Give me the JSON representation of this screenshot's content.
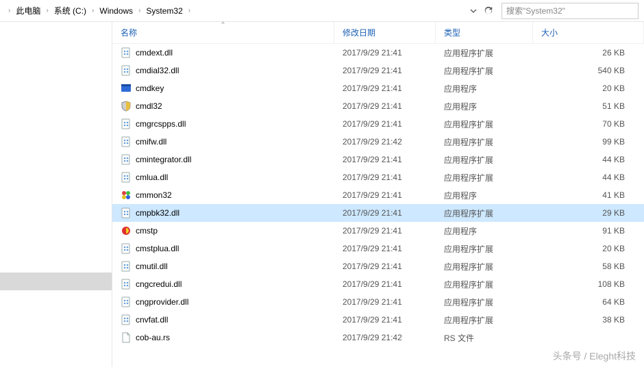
{
  "breadcrumb": {
    "items": [
      "此电脑",
      "系统 (C:)",
      "Windows",
      "System32"
    ]
  },
  "search": {
    "placeholder": "搜索\"System32\""
  },
  "columns": {
    "name": "名称",
    "date": "修改日期",
    "type": "类型",
    "size": "大小"
  },
  "types": {
    "dll": "应用程序扩展",
    "exe": "应用程序",
    "rs": "RS 文件"
  },
  "files": [
    {
      "icon": "dll",
      "name": "cmdext.dll",
      "date": "2017/9/29 21:41",
      "typekey": "dll",
      "size": "26 KB",
      "selected": false
    },
    {
      "icon": "dll",
      "name": "cmdial32.dll",
      "date": "2017/9/29 21:41",
      "typekey": "dll",
      "size": "540 KB",
      "selected": false
    },
    {
      "icon": "exe-blue",
      "name": "cmdkey",
      "date": "2017/9/29 21:41",
      "typekey": "exe",
      "size": "20 KB",
      "selected": false
    },
    {
      "icon": "exe-shield",
      "name": "cmdl32",
      "date": "2017/9/29 21:41",
      "typekey": "exe",
      "size": "51 KB",
      "selected": false
    },
    {
      "icon": "dll",
      "name": "cmgrcspps.dll",
      "date": "2017/9/29 21:41",
      "typekey": "dll",
      "size": "70 KB",
      "selected": false
    },
    {
      "icon": "dll",
      "name": "cmifw.dll",
      "date": "2017/9/29 21:42",
      "typekey": "dll",
      "size": "99 KB",
      "selected": false
    },
    {
      "icon": "dll",
      "name": "cmintegrator.dll",
      "date": "2017/9/29 21:41",
      "typekey": "dll",
      "size": "44 KB",
      "selected": false
    },
    {
      "icon": "dll",
      "name": "cmlua.dll",
      "date": "2017/9/29 21:41",
      "typekey": "dll",
      "size": "44 KB",
      "selected": false
    },
    {
      "icon": "exe-colors",
      "name": "cmmon32",
      "date": "2017/9/29 21:41",
      "typekey": "exe",
      "size": "41 KB",
      "selected": false
    },
    {
      "icon": "dll",
      "name": "cmpbk32.dll",
      "date": "2017/9/29 21:41",
      "typekey": "dll",
      "size": "29 KB",
      "selected": true
    },
    {
      "icon": "exe-red",
      "name": "cmstp",
      "date": "2017/9/29 21:41",
      "typekey": "exe",
      "size": "91 KB",
      "selected": false
    },
    {
      "icon": "dll",
      "name": "cmstplua.dll",
      "date": "2017/9/29 21:41",
      "typekey": "dll",
      "size": "20 KB",
      "selected": false
    },
    {
      "icon": "dll",
      "name": "cmutil.dll",
      "date": "2017/9/29 21:41",
      "typekey": "dll",
      "size": "58 KB",
      "selected": false
    },
    {
      "icon": "dll",
      "name": "cngcredui.dll",
      "date": "2017/9/29 21:41",
      "typekey": "dll",
      "size": "108 KB",
      "selected": false
    },
    {
      "icon": "dll",
      "name": "cngprovider.dll",
      "date": "2017/9/29 21:41",
      "typekey": "dll",
      "size": "64 KB",
      "selected": false
    },
    {
      "icon": "dll",
      "name": "cnvfat.dll",
      "date": "2017/9/29 21:41",
      "typekey": "dll",
      "size": "38 KB",
      "selected": false
    },
    {
      "icon": "file",
      "name": "cob-au.rs",
      "date": "2017/9/29 21:42",
      "typekey": "rs",
      "size": "",
      "selected": false
    }
  ],
  "watermark": "头条号 / Eleght科技"
}
